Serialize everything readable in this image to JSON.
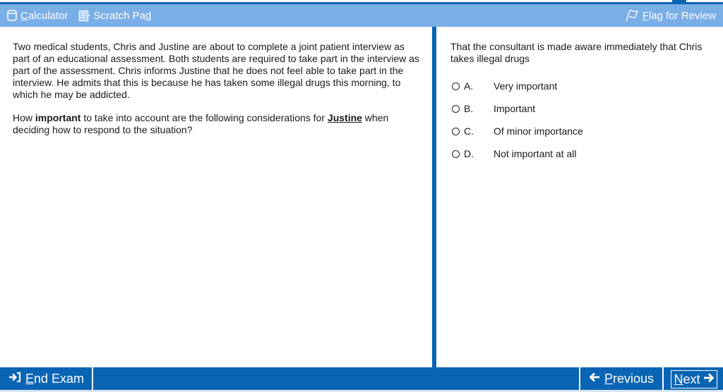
{
  "toolbar": {
    "calculator_label": "Calculator",
    "calculator_access_key": "C",
    "calculator_rest": "alculator",
    "scratch_pad_label_pre": "Scratch Pa",
    "scratch_pad_label_key": "d",
    "flag_pre": "",
    "flag_key": "F",
    "flag_rest": "lag for Review"
  },
  "scenario": {
    "paragraph": "Two medical students, Chris and Justine are about to complete a joint patient interview as part of an educational assessment. Both students are required to take part in the interview as part of the assessment. Chris informs Justine that he does not feel able to take part in the interview. He admits that this is because he has taken some illegal drugs this morning, to which he may be addicted.",
    "question_pre": "How ",
    "question_bold": "important",
    "question_mid": " to take into account are the following considerations for ",
    "question_name": "Justine",
    "question_post": " when deciding how to respond to the situation?"
  },
  "item": {
    "stem": "That the consultant is made aware immediately that Chris takes illegal drugs",
    "options": [
      {
        "letter": "A.",
        "text": "Very important"
      },
      {
        "letter": "B.",
        "text": "Important"
      },
      {
        "letter": "C.",
        "text": "Of minor importance"
      },
      {
        "letter": "D.",
        "text": "Not important at all"
      }
    ]
  },
  "nav": {
    "end_exam_key": "E",
    "end_exam_rest": "nd Exam",
    "previous_key": "P",
    "previous_rest": "revious",
    "next_key": "N",
    "next_rest": "ext"
  },
  "colors": {
    "toolbar_bg": "#79aee6",
    "accent_blue": "#0a64b4"
  }
}
